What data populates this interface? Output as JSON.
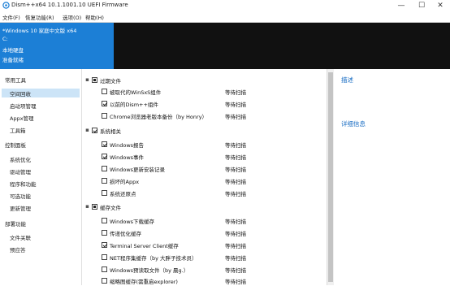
{
  "window": {
    "title": "Dism++x64 10.1.1001.10 UEFI Firmware",
    "buttons": {
      "minimize": "—",
      "maximize": "☐",
      "close": "✕"
    }
  },
  "menu": [
    "文件(F)",
    "恢复功能(R)",
    "选项(O)",
    "帮助(H)"
  ],
  "header": {
    "lines": [
      "*Windows 10 家庭中文版 x64",
      "C:",
      "本地硬盘",
      "准备就绪"
    ]
  },
  "sidebar": {
    "groups": [
      {
        "title": "常用工具",
        "items": [
          "空间回收",
          "启动项管理",
          "Appx管理",
          "工具箱"
        ]
      },
      {
        "title": "控制面板",
        "items": [
          "系统优化",
          "驱动管理",
          "程序和功能",
          "可选功能",
          "更新管理"
        ]
      },
      {
        "title": "部署功能",
        "items": [
          "文件关联",
          "预应答"
        ]
      }
    ],
    "selected": "空间回收"
  },
  "list": {
    "status_text": "等待扫描",
    "sections": [
      {
        "title": "过期文件",
        "state": "partial",
        "items": [
          {
            "label": "被取代的WinSxS组件",
            "checked": false,
            "status": "等待扫描"
          },
          {
            "label": "以前的Dism++组件",
            "checked": true,
            "status": "等待扫描"
          },
          {
            "label": "Chrome浏览器老版本备份（by Honry）",
            "checked": false,
            "status": "等待扫描"
          }
        ]
      },
      {
        "title": "系统相关",
        "state": "checked",
        "items": [
          {
            "label": "Windows报告",
            "checked": true,
            "status": "等待扫描"
          },
          {
            "label": "Windows事件",
            "checked": true,
            "status": "等待扫描"
          },
          {
            "label": "Windows更新安装记录",
            "checked": false,
            "status": "等待扫描"
          },
          {
            "label": "损坏的Appx",
            "checked": false,
            "status": "等待扫描"
          },
          {
            "label": "系统还原点",
            "checked": false,
            "status": "等待扫描"
          }
        ]
      },
      {
        "title": "缓存文件",
        "state": "partial",
        "items": [
          {
            "label": "Windows下载缓存",
            "checked": false,
            "status": "等待扫描"
          },
          {
            "label": "传递优化缓存",
            "checked": false,
            "status": "等待扫描"
          },
          {
            "label": "Terminal Server Client缓存",
            "checked": true,
            "status": "等待扫描"
          },
          {
            "label": "NET程序集缓存（by 大胖子技术员）",
            "checked": false,
            "status": "等待扫描"
          },
          {
            "label": "Windows预读取文件（by 晨g.）",
            "checked": false,
            "status": "等待扫描"
          },
          {
            "label": "缩略图缓存(需重启explorer)",
            "checked": false,
            "status": "等待扫描"
          }
        ]
      }
    ]
  },
  "right_panel": {
    "links": [
      "描述",
      "详细信息"
    ]
  }
}
